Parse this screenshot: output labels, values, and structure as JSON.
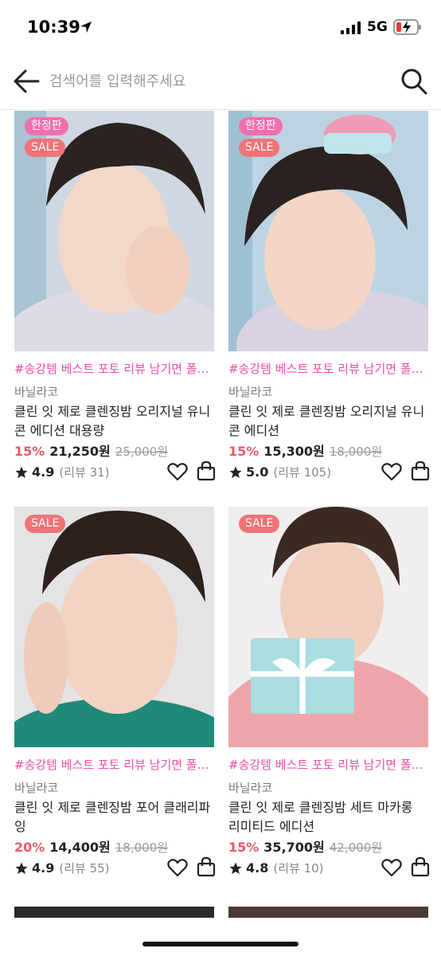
{
  "status": {
    "time": "10:39",
    "network": "5G",
    "location_icon": "location-arrow-icon",
    "signal_icon": "signal-bars-icon",
    "battery_icon": "battery-charging-icon"
  },
  "search": {
    "placeholder": "검색어를 입력해주세요",
    "value": "",
    "back_icon": "back-arrow-icon",
    "search_icon": "search-icon"
  },
  "colors": {
    "promo": "#e94ea8",
    "discount": "#ea5967",
    "limited_badge": "#f16fae",
    "sale_badge": "#f07379"
  },
  "products": [
    {
      "badges": [
        "한정판",
        "SALE"
      ],
      "promo": "#송강템 베스트 포토 리뷰 남기면 폴…",
      "brand": "바닐라코",
      "name": "클린 잇 제로 클렌징밤 오리지널 유니콘 에디션 대용량",
      "discount": "15%",
      "price": "21,250원",
      "original_price": "25,000원",
      "rating": "4.9",
      "reviews": "(리뷰 31)"
    },
    {
      "badges": [
        "한정판",
        "SALE"
      ],
      "promo": "#송강템 베스트 포토 리뷰 남기면 폴…",
      "brand": "바닐라코",
      "name": "클린 잇 제로 클렌징밤 오리지널 유니콘 에디션",
      "discount": "15%",
      "price": "15,300원",
      "original_price": "18,000원",
      "rating": "5.0",
      "reviews": "(리뷰 105)"
    },
    {
      "badges": [
        "SALE"
      ],
      "promo": "#송강템 베스트 포토 리뷰 남기면 폴…",
      "brand": "바닐라코",
      "name": "클린 잇 제로 클렌징밤 포어 클래리파잉",
      "discount": "20%",
      "price": "14,400원",
      "original_price": "18,000원",
      "rating": "4.9",
      "reviews": "(리뷰 55)"
    },
    {
      "badges": [
        "SALE"
      ],
      "promo": "#송강템 베스트 포토 리뷰 남기면 폴…",
      "brand": "바닐라코",
      "name": "클린 잇 제로 클렌징밤 세트 마카롱 리미티드 에디션",
      "discount": "15%",
      "price": "35,700원",
      "original_price": "42,000원",
      "rating": "4.8",
      "reviews": "(리뷰 10)"
    }
  ]
}
